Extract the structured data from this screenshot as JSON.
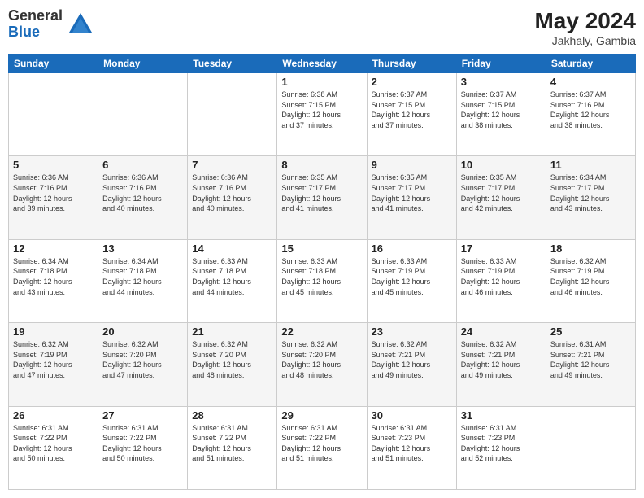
{
  "header": {
    "logo_general": "General",
    "logo_blue": "Blue",
    "month_year": "May 2024",
    "location": "Jakhaly, Gambia"
  },
  "weekdays": [
    "Sunday",
    "Monday",
    "Tuesday",
    "Wednesday",
    "Thursday",
    "Friday",
    "Saturday"
  ],
  "weeks": [
    [
      {
        "day": "",
        "info": ""
      },
      {
        "day": "",
        "info": ""
      },
      {
        "day": "",
        "info": ""
      },
      {
        "day": "1",
        "info": "Sunrise: 6:38 AM\nSunset: 7:15 PM\nDaylight: 12 hours\nand 37 minutes."
      },
      {
        "day": "2",
        "info": "Sunrise: 6:37 AM\nSunset: 7:15 PM\nDaylight: 12 hours\nand 37 minutes."
      },
      {
        "day": "3",
        "info": "Sunrise: 6:37 AM\nSunset: 7:15 PM\nDaylight: 12 hours\nand 38 minutes."
      },
      {
        "day": "4",
        "info": "Sunrise: 6:37 AM\nSunset: 7:16 PM\nDaylight: 12 hours\nand 38 minutes."
      }
    ],
    [
      {
        "day": "5",
        "info": "Sunrise: 6:36 AM\nSunset: 7:16 PM\nDaylight: 12 hours\nand 39 minutes."
      },
      {
        "day": "6",
        "info": "Sunrise: 6:36 AM\nSunset: 7:16 PM\nDaylight: 12 hours\nand 40 minutes."
      },
      {
        "day": "7",
        "info": "Sunrise: 6:36 AM\nSunset: 7:16 PM\nDaylight: 12 hours\nand 40 minutes."
      },
      {
        "day": "8",
        "info": "Sunrise: 6:35 AM\nSunset: 7:17 PM\nDaylight: 12 hours\nand 41 minutes."
      },
      {
        "day": "9",
        "info": "Sunrise: 6:35 AM\nSunset: 7:17 PM\nDaylight: 12 hours\nand 41 minutes."
      },
      {
        "day": "10",
        "info": "Sunrise: 6:35 AM\nSunset: 7:17 PM\nDaylight: 12 hours\nand 42 minutes."
      },
      {
        "day": "11",
        "info": "Sunrise: 6:34 AM\nSunset: 7:17 PM\nDaylight: 12 hours\nand 43 minutes."
      }
    ],
    [
      {
        "day": "12",
        "info": "Sunrise: 6:34 AM\nSunset: 7:18 PM\nDaylight: 12 hours\nand 43 minutes."
      },
      {
        "day": "13",
        "info": "Sunrise: 6:34 AM\nSunset: 7:18 PM\nDaylight: 12 hours\nand 44 minutes."
      },
      {
        "day": "14",
        "info": "Sunrise: 6:33 AM\nSunset: 7:18 PM\nDaylight: 12 hours\nand 44 minutes."
      },
      {
        "day": "15",
        "info": "Sunrise: 6:33 AM\nSunset: 7:18 PM\nDaylight: 12 hours\nand 45 minutes."
      },
      {
        "day": "16",
        "info": "Sunrise: 6:33 AM\nSunset: 7:19 PM\nDaylight: 12 hours\nand 45 minutes."
      },
      {
        "day": "17",
        "info": "Sunrise: 6:33 AM\nSunset: 7:19 PM\nDaylight: 12 hours\nand 46 minutes."
      },
      {
        "day": "18",
        "info": "Sunrise: 6:32 AM\nSunset: 7:19 PM\nDaylight: 12 hours\nand 46 minutes."
      }
    ],
    [
      {
        "day": "19",
        "info": "Sunrise: 6:32 AM\nSunset: 7:19 PM\nDaylight: 12 hours\nand 47 minutes."
      },
      {
        "day": "20",
        "info": "Sunrise: 6:32 AM\nSunset: 7:20 PM\nDaylight: 12 hours\nand 47 minutes."
      },
      {
        "day": "21",
        "info": "Sunrise: 6:32 AM\nSunset: 7:20 PM\nDaylight: 12 hours\nand 48 minutes."
      },
      {
        "day": "22",
        "info": "Sunrise: 6:32 AM\nSunset: 7:20 PM\nDaylight: 12 hours\nand 48 minutes."
      },
      {
        "day": "23",
        "info": "Sunrise: 6:32 AM\nSunset: 7:21 PM\nDaylight: 12 hours\nand 49 minutes."
      },
      {
        "day": "24",
        "info": "Sunrise: 6:32 AM\nSunset: 7:21 PM\nDaylight: 12 hours\nand 49 minutes."
      },
      {
        "day": "25",
        "info": "Sunrise: 6:31 AM\nSunset: 7:21 PM\nDaylight: 12 hours\nand 49 minutes."
      }
    ],
    [
      {
        "day": "26",
        "info": "Sunrise: 6:31 AM\nSunset: 7:22 PM\nDaylight: 12 hours\nand 50 minutes."
      },
      {
        "day": "27",
        "info": "Sunrise: 6:31 AM\nSunset: 7:22 PM\nDaylight: 12 hours\nand 50 minutes."
      },
      {
        "day": "28",
        "info": "Sunrise: 6:31 AM\nSunset: 7:22 PM\nDaylight: 12 hours\nand 51 minutes."
      },
      {
        "day": "29",
        "info": "Sunrise: 6:31 AM\nSunset: 7:22 PM\nDaylight: 12 hours\nand 51 minutes."
      },
      {
        "day": "30",
        "info": "Sunrise: 6:31 AM\nSunset: 7:23 PM\nDaylight: 12 hours\nand 51 minutes."
      },
      {
        "day": "31",
        "info": "Sunrise: 6:31 AM\nSunset: 7:23 PM\nDaylight: 12 hours\nand 52 minutes."
      },
      {
        "day": "",
        "info": ""
      }
    ]
  ]
}
